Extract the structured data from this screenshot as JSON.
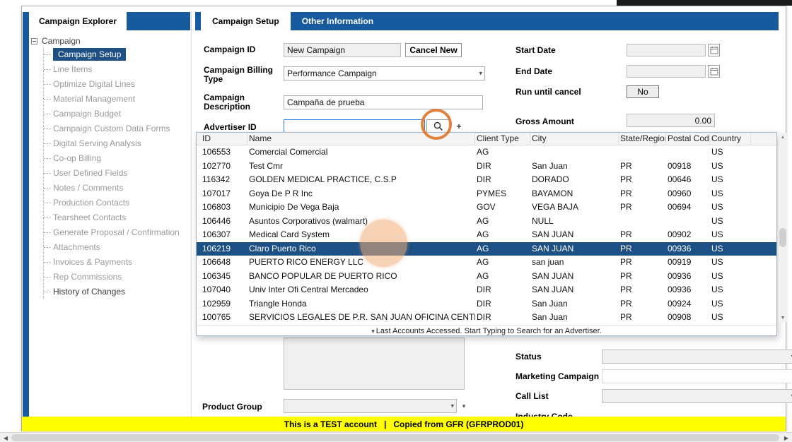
{
  "colors": {
    "accent_blue": "#175A9D",
    "selection_blue": "#1D5084",
    "warning_yellow": "#FFFF00"
  },
  "icons": {
    "caret_down": "▾",
    "arrow_up": "▲",
    "arrow_down": "▼",
    "arrow_left": "◀",
    "arrow_right": "▶",
    "plus": "+"
  },
  "sidebar": {
    "tab_label": "Campaign Explorer",
    "root_label": "Campaign",
    "items": [
      {
        "label": "Campaign Setup",
        "selected": true
      },
      {
        "label": "Line Items"
      },
      {
        "label": "Optimize Digital Lines"
      },
      {
        "label": "Material Management"
      },
      {
        "label": "Campaign Budget"
      },
      {
        "label": "Campaign Custom Data Forms"
      },
      {
        "label": "Digital Serving Analysis"
      },
      {
        "label": "Co-op Billing"
      },
      {
        "label": "User Defined Fields"
      },
      {
        "label": "Notes / Comments"
      },
      {
        "label": "Production Contacts"
      },
      {
        "label": "Tearsheet Contacts"
      },
      {
        "label": "Generate Proposal / Confirmation"
      },
      {
        "label": "Attachments"
      },
      {
        "label": "Invoices & Payments"
      },
      {
        "label": "Rep Commissions"
      },
      {
        "label": "History of Changes",
        "emphasized": true
      }
    ]
  },
  "tabs": {
    "active": "Campaign Setup",
    "inactive": "Other Information"
  },
  "form": {
    "campaign_id_label": "Campaign ID",
    "campaign_id_value": "New Campaign",
    "cancel_new_label": "Cancel New",
    "billing_label": "Campaign Billing Type",
    "billing_value": "Performance Campaign",
    "description_label": "Campaign Description",
    "description_value": "Campaña de prueba",
    "advertiser_label": "Advertiser ID",
    "advertiser_value": "",
    "start_date_label": "Start Date",
    "start_date_value": "",
    "end_date_label": "End Date",
    "end_date_value": "",
    "run_until_cancel_label": "Run until cancel",
    "run_until_cancel_value": "No",
    "gross_amount_label": "Gross Amount",
    "gross_amount_value": "0.00",
    "product_group_label": "Product Group",
    "product_group_value": "",
    "status_label": "Status",
    "status_value": "",
    "marketing_campaign_label": "Marketing Campaign",
    "marketing_campaign_value": "",
    "call_list_label": "Call List",
    "call_list_value": "",
    "industry_code_label": "Industry Code"
  },
  "grid": {
    "columns": [
      "ID",
      "Name",
      "Client Type",
      "City",
      "State/Region",
      "Postal Code",
      "Country"
    ],
    "selected_id": "106219",
    "footer_text": "Last Accounts Accessed. Start Typing to Search for an Advertiser.",
    "rows": [
      [
        "106553",
        "Comercial Comercial",
        "AG",
        "",
        "",
        "",
        "US"
      ],
      [
        "102770",
        "Test Cmr",
        "DIR",
        "San Juan",
        "PR",
        "00918",
        "US"
      ],
      [
        "116342",
        "GOLDEN MEDICAL PRACTICE, C.S.P",
        "DIR",
        "DORADO",
        "PR",
        "00646",
        "US"
      ],
      [
        "107017",
        "Goya De P R Inc",
        "PYMES",
        "BAYAMON",
        "PR",
        "00960",
        "US"
      ],
      [
        "106803",
        "Municipio De Vega Baja",
        "GOV",
        "VEGA BAJA",
        "PR",
        "00694",
        "US"
      ],
      [
        "106446",
        "Asuntos Corporativos (walmart)",
        "AG",
        "NULL",
        "",
        "",
        "US"
      ],
      [
        "106307",
        "Medical Card System",
        "AG",
        "SAN JUAN",
        "PR",
        "00902",
        "US"
      ],
      [
        "106219",
        "Claro Puerto Rico",
        "AG",
        "SAN JUAN",
        "PR",
        "00936",
        "US"
      ],
      [
        "106648",
        "PUERTO RICO ENERGY LLC",
        "AG",
        "san juan",
        "PR",
        "00919",
        "US"
      ],
      [
        "106345",
        "BANCO POPULAR DE PUERTO RICO",
        "AG",
        "SAN JUAN",
        "PR",
        "00936",
        "US"
      ],
      [
        "107040",
        "Univ Inter Ofi Central Mercadeo",
        "DIR",
        "SAN JUAN",
        "PR",
        "00936",
        "US"
      ],
      [
        "102959",
        "Triangle Honda",
        "DIR",
        "San Juan",
        "PR",
        "00924",
        "US"
      ],
      [
        "100765",
        "SERVICIOS LEGALES DE P.R. SAN JUAN OFICINA CENTRAL",
        "DIR",
        "San Juan",
        "PR",
        "00908",
        "US"
      ]
    ]
  },
  "status_bar": {
    "text": "This is a TEST account   |   Copied from GFR (GFRPROD01)"
  }
}
